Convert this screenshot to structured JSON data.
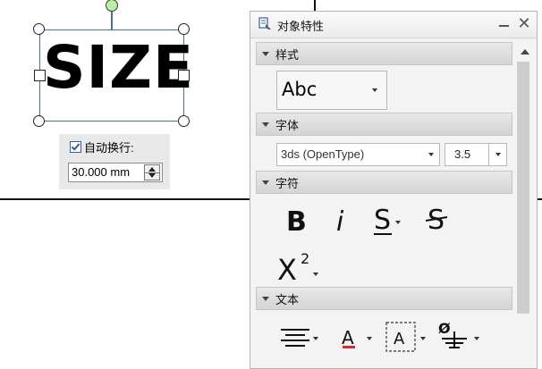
{
  "canvas": {
    "text_object": {
      "content": "SIZE"
    },
    "wrap_panel": {
      "auto_wrap_label": "自动换行:",
      "auto_wrap_checked": true,
      "width_value": "30.000 mm"
    }
  },
  "properties_panel": {
    "title": "对象特性",
    "sections": {
      "style": {
        "header": "样式",
        "text_style_value": "Abc"
      },
      "font": {
        "header": "字体",
        "font_name": "3ds (OpenType)",
        "font_size": "3.5"
      },
      "character": {
        "header": "字符",
        "buttons": [
          "bold-button",
          "italic-button",
          "underline-s-button",
          "strikethrough-s-button",
          "superscript-button"
        ]
      },
      "text": {
        "header": "文本",
        "buttons": [
          "align-button",
          "text-color-button",
          "text-frame-button",
          "diameter-symbol-button"
        ]
      }
    }
  },
  "colors": {
    "selection_frame": "#4a6f9a",
    "rotation_grip": "#b9f0a8",
    "text_color_accent": "#d22a2a"
  }
}
